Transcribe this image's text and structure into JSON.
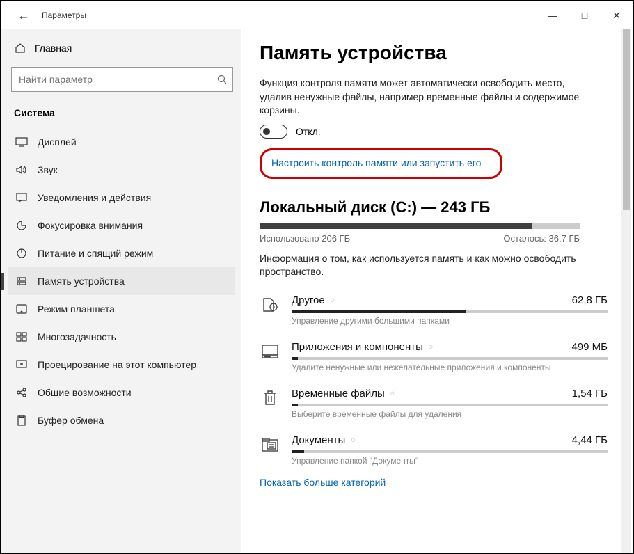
{
  "titlebar": {
    "title": "Параметры"
  },
  "sidebar": {
    "home": "Главная",
    "search_placeholder": "Найти параметр",
    "category": "Система",
    "items": [
      {
        "label": "Дисплей"
      },
      {
        "label": "Звук"
      },
      {
        "label": "Уведомления и действия"
      },
      {
        "label": "Фокусировка внимания"
      },
      {
        "label": "Питание и спящий режим"
      },
      {
        "label": "Память устройства"
      },
      {
        "label": "Режим планшета"
      },
      {
        "label": "Многозадачность"
      },
      {
        "label": "Проецирование на этот компьютер"
      },
      {
        "label": "Общие возможности"
      },
      {
        "label": "Буфер обмена"
      }
    ]
  },
  "content": {
    "heading": "Память устройства",
    "desc": "Функция контроля памяти может автоматически освободить место, удалив ненужные файлы, например временные файлы и содержимое корзины.",
    "toggle_state": "Откл.",
    "config_link": "Настроить контроль памяти или запустить его",
    "disk": {
      "title": "Локальный диск (C:) — 243 ГБ",
      "used_label": "Использовано 206 ГБ",
      "free_label": "Осталось: 36,7 ГБ",
      "used_pct": 85,
      "info": "Информация о том, как используется память и как можно освободить пространство."
    },
    "categories": [
      {
        "name": "Другое",
        "size": "62,8 ГБ",
        "pct": 55,
        "hint": "Управление другими большими папками"
      },
      {
        "name": "Приложения и компоненты",
        "size": "499 МБ",
        "pct": 2,
        "hint": "Удалите ненужные или нежелательные приложения и компоненты"
      },
      {
        "name": "Временные файлы",
        "size": "1,54 ГБ",
        "pct": 2,
        "hint": "Выберите временные файлы для удаления"
      },
      {
        "name": "Документы",
        "size": "4,44 ГБ",
        "pct": 4,
        "hint": "Управление папкой \"Документы\""
      }
    ],
    "more_link": "Показать больше категорий"
  }
}
